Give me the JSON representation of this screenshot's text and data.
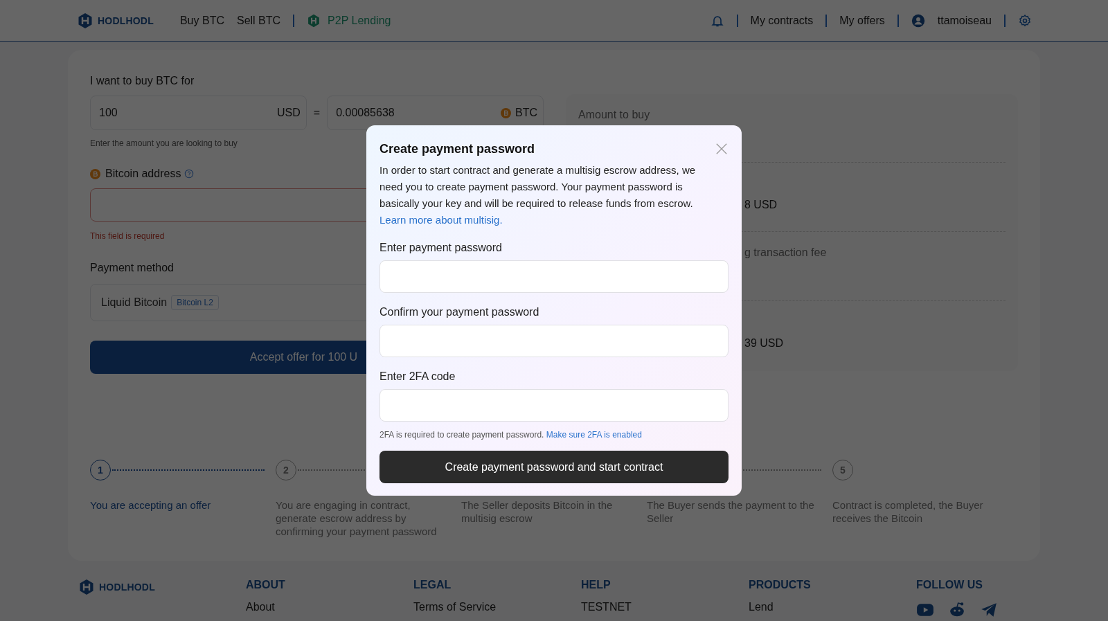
{
  "header": {
    "logo": "HODLHODL",
    "nav": [
      "Buy BTC",
      "Sell BTC"
    ],
    "product_link": "P2P Lending",
    "links": [
      "My contracts",
      "My offers"
    ],
    "user": "ttamoiseau"
  },
  "form": {
    "title": "I want to buy BTC for",
    "amount": {
      "value": "100",
      "currency": "USD"
    },
    "equals": "=",
    "btc": {
      "value": "0.00085638",
      "currency": "BTC"
    },
    "hint": "Enter the amount you are looking to buy",
    "address": {
      "label": "Bitcoin address",
      "invalid": true,
      "error": "This field is required"
    },
    "payment_method": {
      "label": "Payment method",
      "value": "Liquid Bitcoin",
      "tag": "Bitcoin L2"
    },
    "accept_button": "Accept offer for 100 U"
  },
  "summary": [
    {
      "label": "Amount to buy"
    },
    {
      "value": "8 USD",
      "cut": true
    },
    {
      "label": "g transaction fee",
      "cut": true
    },
    {
      "value": "39 USD",
      "cut": true
    }
  ],
  "steps": [
    {
      "number": "1",
      "text": "You are accepting an offer",
      "selected": true
    },
    {
      "number": "2",
      "text": "You are engaging in contract, generate escrow address by confirming your payment password",
      "selected": false
    },
    {
      "text": "The Seller deposits Bitcoin in the multisig escrow",
      "selected": false
    },
    {
      "text": "The Buyer sends the payment to the Seller",
      "selected": false
    },
    {
      "number": "5",
      "text": "Contract is completed, the Buyer receives the Bitcoin",
      "selected": false
    }
  ],
  "dialog": {
    "title": "Create payment password",
    "text": "In order to start contract and generate a multisig escrow address, we need you to create payment password. Your payment password is basically your key and will be required to release funds from escrow.",
    "link": "Learn more about multisig.",
    "fields": [
      {
        "label": "Enter payment password"
      },
      {
        "label": "Confirm your payment password"
      },
      {
        "label": "Enter 2FA code"
      }
    ],
    "note": "2FA is required to create payment password.",
    "note_link": "Make sure 2FA is enabled",
    "submit": "Create payment password and start contract"
  },
  "footer": {
    "logo": "HODLHODL",
    "columns": [
      {
        "heading": "ABOUT",
        "links": [
          "About"
        ]
      },
      {
        "heading": "LEGAL",
        "links": [
          "Terms of Service"
        ]
      },
      {
        "heading": "HELP",
        "links": [
          "TESTNET"
        ]
      },
      {
        "heading": "PRODUCTS",
        "links": [
          "Lend"
        ]
      }
    ],
    "follow": "FOLLOW US"
  }
}
